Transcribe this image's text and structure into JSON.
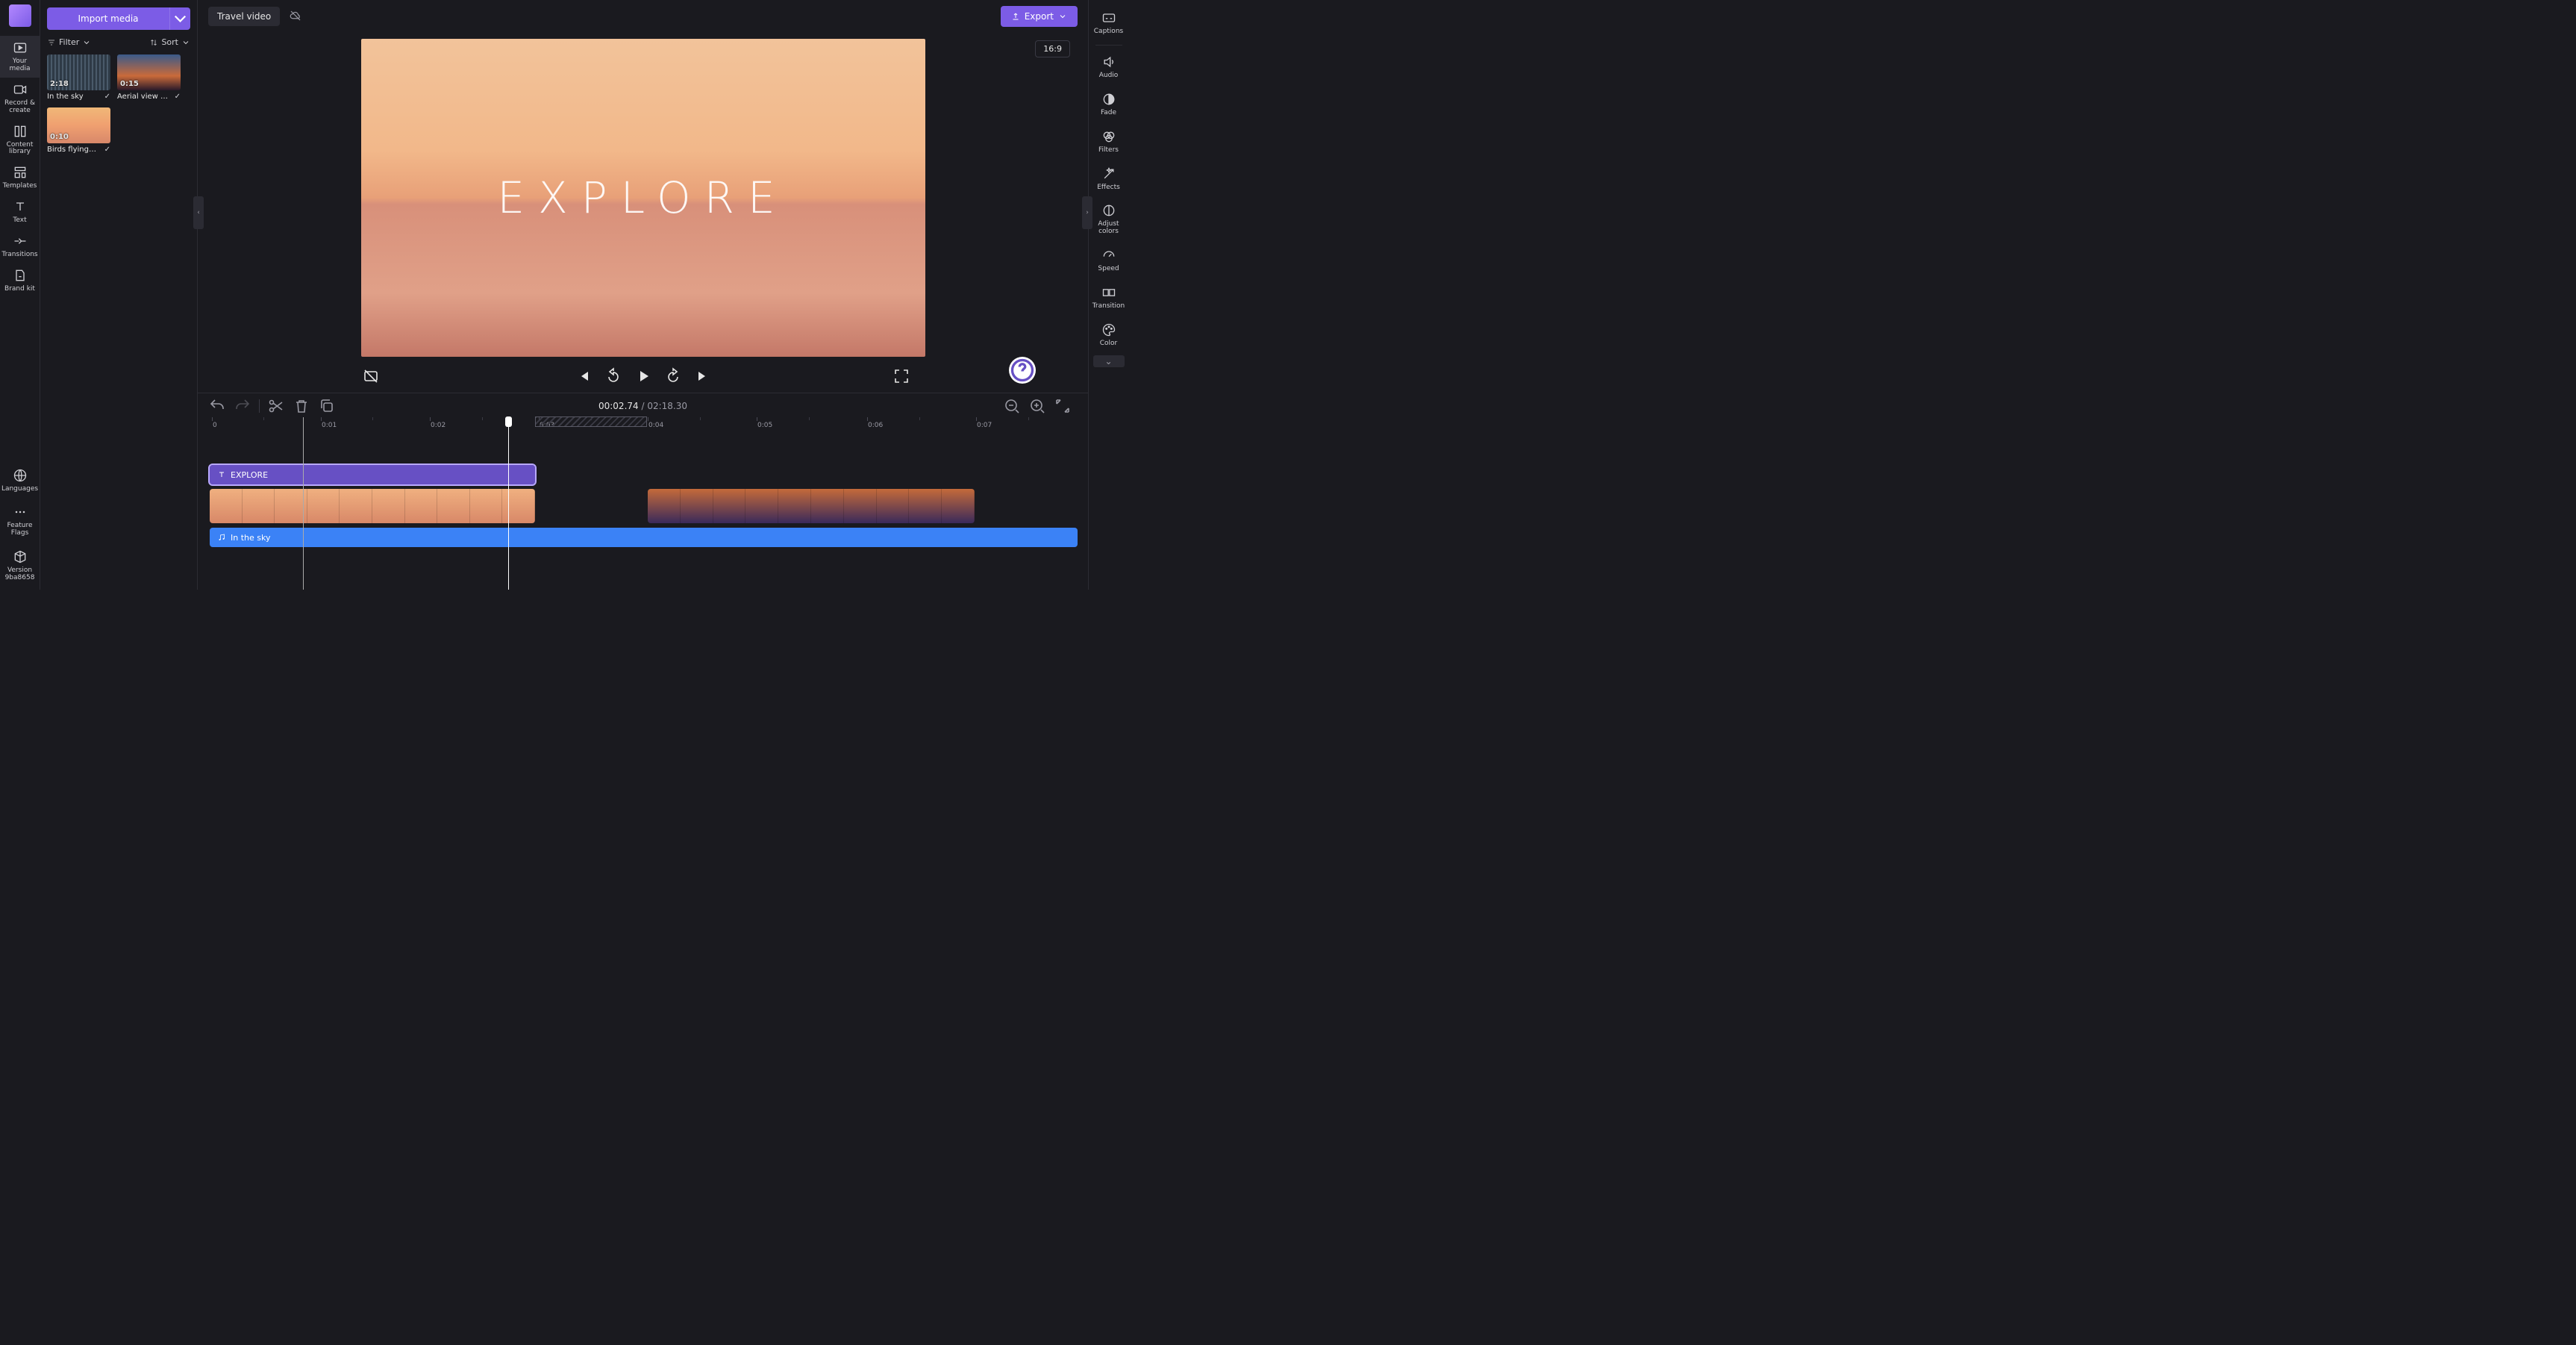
{
  "sidebar": {
    "your_media": "Your media",
    "record_create": "Record & create",
    "content_library": "Content library",
    "templates": "Templates",
    "text": "Text",
    "transitions": "Transitions",
    "brand_kit": "Brand kit",
    "languages": "Languages",
    "feature_flags": "Feature Flags",
    "version_label": "Version",
    "version_value": "9ba8658"
  },
  "media_panel": {
    "import_label": "Import media",
    "filter_label": "Filter",
    "sort_label": "Sort",
    "items": [
      {
        "name": "In the sky",
        "duration": "2:18"
      },
      {
        "name": "Aerial view of ...",
        "duration": "0:15"
      },
      {
        "name": "Birds flying ab...",
        "duration": "0:10"
      }
    ]
  },
  "header": {
    "project_title": "Travel video",
    "export_label": "Export",
    "aspect_ratio": "16:9"
  },
  "preview": {
    "overlay_text": "EXPLORE"
  },
  "timeline": {
    "current_time": "00:02.74",
    "total_time": "02:18.30",
    "ruler": [
      "0",
      "0:01",
      "0:02",
      "0:03",
      "0:04",
      "0:05",
      "0:06",
      "0:07"
    ],
    "text_clip_label": "EXPLORE",
    "audio_clip_label": "In the sky"
  },
  "right_panel": {
    "captions": "Captions",
    "audio": "Audio",
    "fade": "Fade",
    "filters": "Filters",
    "effects": "Effects",
    "adjust_colors": "Adjust colors",
    "speed": "Speed",
    "transition": "Transition",
    "color": "Color"
  }
}
